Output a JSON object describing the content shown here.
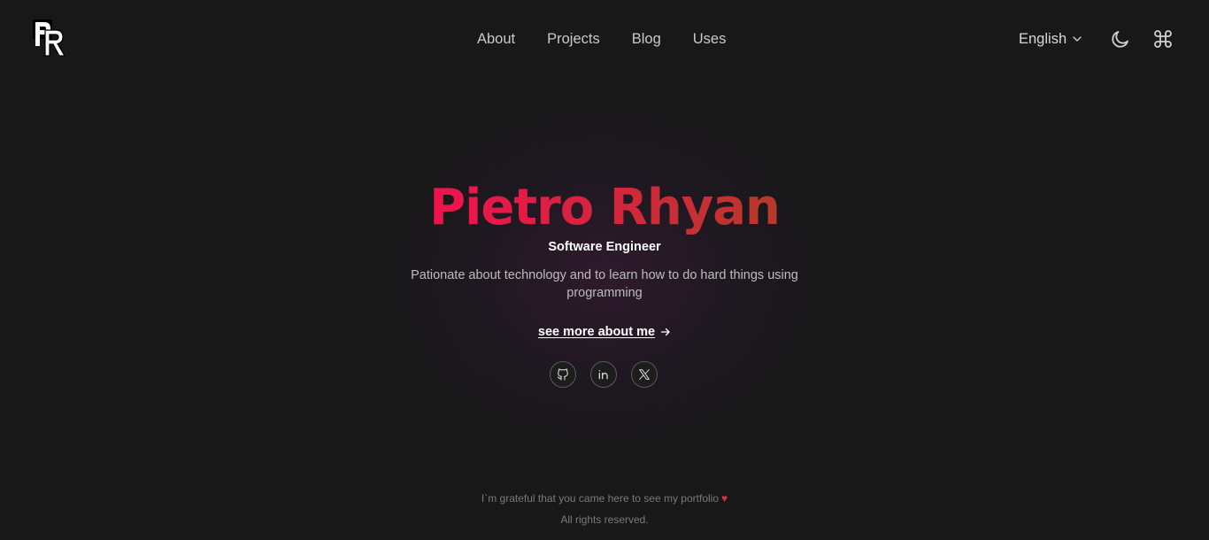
{
  "header": {
    "logo_text": "PR",
    "nav": [
      {
        "label": "About"
      },
      {
        "label": "Projects"
      },
      {
        "label": "Blog"
      },
      {
        "label": "Uses"
      }
    ],
    "language": "English",
    "icons": {
      "theme": "moon-icon",
      "command": "command-icon"
    }
  },
  "hero": {
    "name": "Pietro Rhyan",
    "role": "Software Engineer",
    "description": "Pationate about technology and to learn how to do hard things using programming",
    "link_label": "see more about me",
    "socials": [
      {
        "icon": "github-icon"
      },
      {
        "icon": "linkedin-icon"
      },
      {
        "icon": "x-icon"
      }
    ],
    "name_gradient": [
      "#f0124e",
      "#b63a2a"
    ]
  },
  "footer": {
    "message": "I`m grateful that you came here to see my portfolio",
    "heart": "♥",
    "rights": "All rights reserved."
  },
  "colors": {
    "background": "#181818",
    "accent": "#f0124e"
  }
}
